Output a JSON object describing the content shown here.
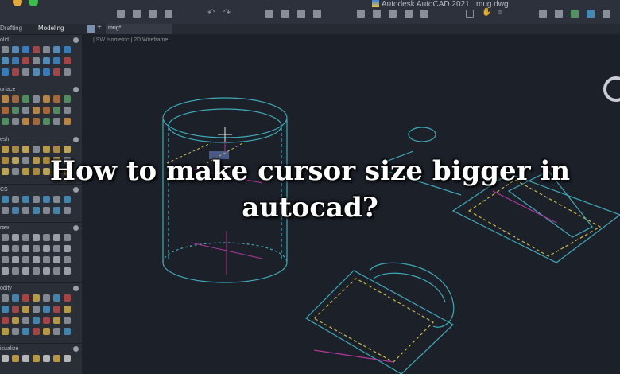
{
  "window": {
    "app_title": "Autodesk AutoCAD 2021",
    "file_name": "mug.dwg"
  },
  "palette_tabs": [
    "Drafting",
    "Modeling"
  ],
  "document_tab": {
    "label": "mug*"
  },
  "viewport_controls": {
    "view": "SW Isometric",
    "visual_style": "2D Wireframe"
  },
  "palette_sections": [
    "olid",
    "urface",
    "esh",
    "CS",
    "raw",
    "odify",
    "isualize"
  ],
  "headline": {
    "line1": "How to make cursor size bigger in",
    "line2": "autocad?"
  },
  "colors": {
    "wireframe": "#3fa9b8",
    "dashed": "#c9b84a",
    "axis": "#b0379c",
    "background": "#1c2029"
  }
}
